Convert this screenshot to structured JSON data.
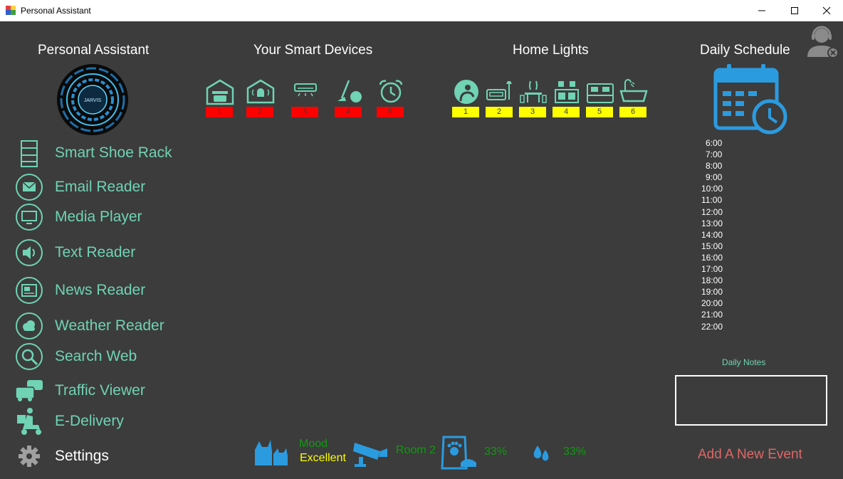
{
  "window": {
    "title": "Personal Assistant"
  },
  "headers": {
    "left": "Personal Assistant",
    "devices": "Your Smart Devices",
    "lights": "Home Lights",
    "schedule": "Daily Schedule"
  },
  "logo_text": "JARVIS",
  "nav": [
    {
      "label": "Smart Shoe Rack",
      "icon": "shoe-rack-icon"
    },
    {
      "label": "Email Reader",
      "icon": "envelope-icon"
    },
    {
      "label": "Media Player",
      "icon": "monitor-icon"
    },
    {
      "label": "Text Reader",
      "icon": "speaker-icon"
    },
    {
      "label": "News Reader",
      "icon": "newspaper-icon"
    },
    {
      "label": "Weather Reader",
      "icon": "weather-cloud-icon"
    },
    {
      "label": "Search Web",
      "icon": "magnifier-icon"
    },
    {
      "label": "Traffic Viewer",
      "icon": "cars-icon"
    },
    {
      "label": "E-Delivery",
      "icon": "delivery-scooter-icon"
    },
    {
      "label": "Settings",
      "icon": "gear-icon"
    }
  ],
  "devices": [
    {
      "num": "1",
      "icon": "garage-icon",
      "status": "off"
    },
    {
      "num": "2",
      "icon": "home-alarm-icon",
      "status": "off"
    },
    {
      "num": "3",
      "icon": "air-conditioner-icon",
      "status": "off"
    },
    {
      "num": "4",
      "icon": "vacuum-cleaner-icon",
      "status": "off"
    },
    {
      "num": "5",
      "icon": "alarm-clock-icon",
      "status": "off"
    }
  ],
  "lights": [
    {
      "num": "1",
      "icon": "room-person-icon",
      "status": "on"
    },
    {
      "num": "2",
      "icon": "living-room-sofa-icon",
      "status": "on"
    },
    {
      "num": "3",
      "icon": "dining-table-icon",
      "status": "on"
    },
    {
      "num": "4",
      "icon": "kitchen-icon",
      "status": "on"
    },
    {
      "num": "5",
      "icon": "bed-icon",
      "status": "on"
    },
    {
      "num": "6",
      "icon": "bathtub-icon",
      "status": "on"
    }
  ],
  "schedule_times": [
    "6:00",
    "7:00",
    "8:00",
    "9:00",
    "10:00",
    "11:00",
    "12:00",
    "13:00",
    "14:00",
    "15:00",
    "16:00",
    "17:00",
    "18:00",
    "19:00",
    "20:00",
    "21:00",
    "22:00"
  ],
  "notes": {
    "label": "Daily Notes",
    "value": ""
  },
  "add_event": "Add A New Event",
  "bottom": {
    "mood_label": "Mood",
    "mood_value": "Excellent",
    "camera_room": "Room 2",
    "pet_food": "33%",
    "water": "33%"
  },
  "colors": {
    "background": "#3c3c3c",
    "accent_teal": "#6fd3b4",
    "icon_blue": "#2b9be0",
    "device_off": "#ff0000",
    "light_on": "#ffff00",
    "status_green": "#119911",
    "add_event": "#e06666"
  }
}
